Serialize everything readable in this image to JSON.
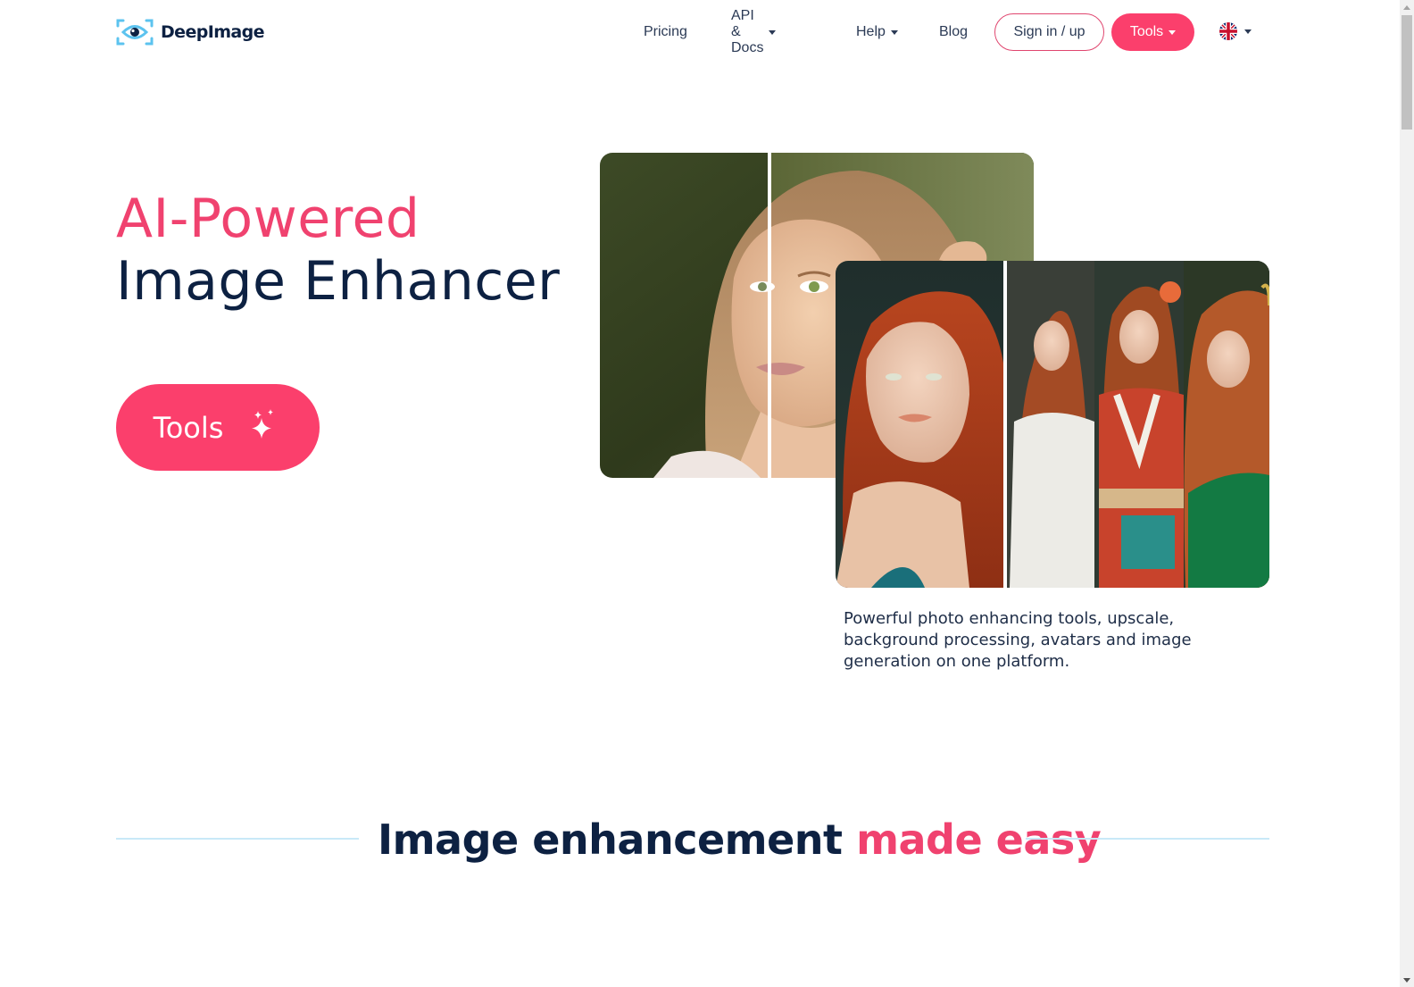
{
  "brand": {
    "name": "DeepImage",
    "accent_color": "#fb3f6c",
    "heading_pink": "#f0426f",
    "navy": "#0d2142",
    "logo_icon": "eye-scan-icon"
  },
  "nav": {
    "items": [
      {
        "label": "Pricing",
        "dropdown": false
      },
      {
        "label": "API & Docs",
        "dropdown": true
      },
      {
        "label": "Help",
        "dropdown": true
      },
      {
        "label": "Blog",
        "dropdown": false
      }
    ],
    "signin_label": "Sign in / up",
    "tools_label": "Tools",
    "language": {
      "icon": "uk-flag-icon",
      "dropdown": true
    }
  },
  "hero": {
    "title_accent": "AI-Powered",
    "title_main": "Image Enhancer",
    "cta_label": "Tools",
    "cta_icon": "sparkles-icon",
    "description": "Powerful photo enhancing tools, upscale, background processing, avatars and image generation on one platform.",
    "images": [
      {
        "name": "before-after-portrait",
        "alt": "Before/after enhancement comparison of a blonde woman's portrait"
      },
      {
        "name": "avatar-generation",
        "alt": "Red-haired woman portrait and generated avatars in wedding dress, kimono and green gown"
      }
    ]
  },
  "section": {
    "heading_main": "Image enhancement ",
    "heading_accent": "made easy"
  },
  "scrollbar": {
    "position_fraction": 0.0
  }
}
